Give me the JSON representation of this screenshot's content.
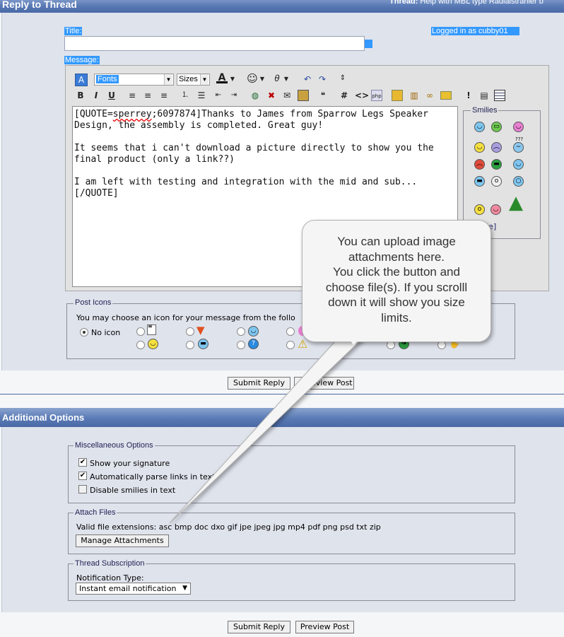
{
  "header": {
    "title": "Reply to Thread",
    "thread_label": "Thread:",
    "thread_title": "Help with MBL type Radialstrahler b"
  },
  "form": {
    "title_label": "Title:",
    "title_value": "",
    "logged_in": "Logged in as cubby01",
    "message_label": "Message:"
  },
  "toolbar": {
    "font_select": "Fonts",
    "size_select": "Sizes",
    "buttons": [
      "bold",
      "italic",
      "underline",
      "align-left",
      "align-center",
      "align-right",
      "ordered-list",
      "unordered-list",
      "outdent",
      "indent",
      "link",
      "unlink",
      "email",
      "image",
      "video",
      "quote",
      "code",
      "html",
      "php",
      "undo",
      "redo"
    ]
  },
  "message": {
    "line1_a": "[QUOTE=",
    "line1_user": "sperrey",
    "line1_b": ";6097874]Thanks to James from Sparrow Legs Speaker Design, the assembly is completed. Great guy!",
    "para2": "It seems that i can't download a picture directly to show you the final product (only a link??)",
    "para3": "I am left with testing and integration with the mid and sub...[/QUOTE]"
  },
  "smilies": {
    "legend": "Smilies",
    "more_fragment": "re]",
    "items": [
      "smile",
      "grin",
      "tongue",
      "happy",
      "mad",
      "confused",
      "frown",
      "cool-green",
      "eek",
      "cool",
      "rolleyes",
      "cry",
      "angry",
      "embarrassed",
      "christmas-tree"
    ]
  },
  "post_icons": {
    "legend": "Post Icons",
    "description": "You may choose an icon for your message from the follo",
    "no_icon": "No icon",
    "selected": "No icon"
  },
  "buttons": {
    "submit": "Submit Reply",
    "preview": "Preview Post",
    "preview_partial": "eview Post"
  },
  "additional": {
    "title": "Additional Options",
    "misc_legend": "Miscellaneous Options",
    "opt_signature": "Show your signature",
    "opt_parse_links": "Automatically parse links in text",
    "opt_disable_smilies": "Disable smilies in text",
    "signature_checked": true,
    "parse_links_checked": true,
    "disable_smilies_checked": false,
    "attach_legend": "Attach Files",
    "valid_extensions": "Valid file extensions: asc bmp doc dxo gif jpe jpeg jpg mp4 pdf png psd txt zip",
    "manage_attachments": "Manage Attachments",
    "subscription_legend": "Thread Subscription",
    "notification_label": "Notification Type:",
    "notification_value": "Instant email notification"
  },
  "callout": {
    "lines": [
      "You can upload image",
      "attachments here.",
      "You click the button and",
      "choose file(s).  If you scrolll",
      "down it will show you size",
      "limits."
    ]
  },
  "colors": {
    "header_bar": "#5a7ab6",
    "panel": "#dfe3ec",
    "selection": "#3399ff"
  }
}
